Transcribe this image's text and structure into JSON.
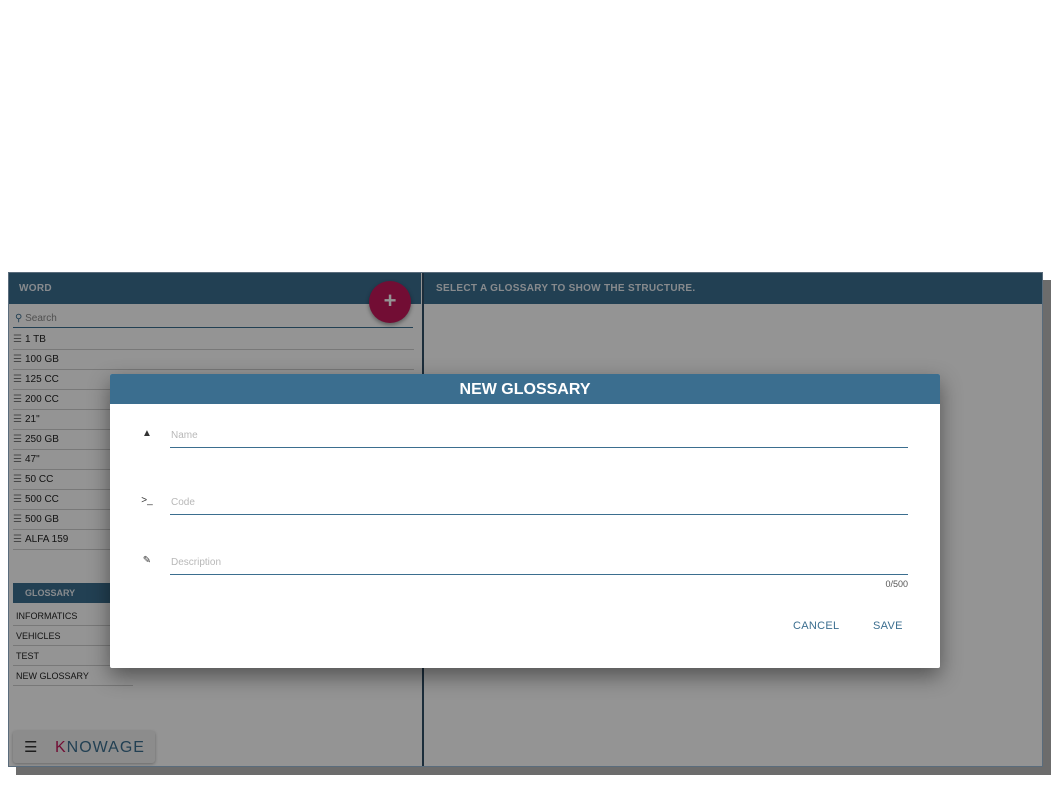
{
  "left_panel": {
    "header": "WORD",
    "add_button_label": "+",
    "search": {
      "placeholder": "Search",
      "value": ""
    },
    "words": [
      "1 TB",
      "100 GB",
      "125 CC",
      "200 CC",
      "21\"",
      "250 GB",
      "47\"",
      "50 CC",
      "500 CC",
      "500 GB",
      "ALFA 159"
    ],
    "glossary_header": "GLOSSARY",
    "glossaries": [
      "INFORMATICS",
      "VEHICLES",
      "TEST",
      "NEW GLOSSARY"
    ],
    "menu": {
      "icon": "hamburger-icon",
      "logo_k": "K",
      "logo_rest": "NOWAGE"
    }
  },
  "right_panel": {
    "header": "SELECT A GLOSSARY TO SHOW THE STRUCTURE."
  },
  "dialog": {
    "title": "NEW GLOSSARY",
    "fields": {
      "name": {
        "icon": "hierarchy-icon",
        "placeholder": "Name",
        "value": ""
      },
      "code": {
        "icon": "terminal-icon",
        "placeholder": "Code",
        "value": ""
      },
      "description": {
        "icon": "edit-icon",
        "placeholder": "Description",
        "value": ""
      }
    },
    "counter": "0/500",
    "cancel_label": "CANCEL",
    "save_label": "SAVE"
  },
  "colors": {
    "primary": "#3b6e8f",
    "accent": "#c4185b"
  }
}
